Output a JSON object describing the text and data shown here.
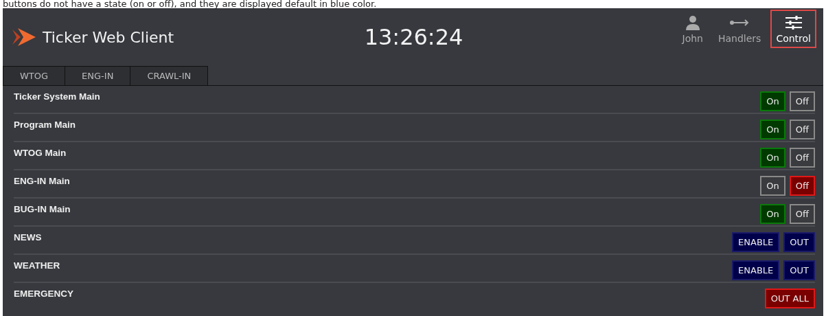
{
  "caption": "buttons do not have a state (on or off), and they are displayed default in blue color.",
  "header": {
    "title": "Ticker Web Client",
    "clock": "13:26:24",
    "nav": [
      {
        "label": "John",
        "kind": "user",
        "selected": false
      },
      {
        "label": "Handlers",
        "kind": "handlers",
        "selected": false
      },
      {
        "label": "Control",
        "kind": "control",
        "selected": true
      }
    ]
  },
  "tabs": [
    {
      "label": "WTOG",
      "selected": false
    },
    {
      "label": "ENG-IN",
      "selected": false
    },
    {
      "label": "CRAWL-IN",
      "selected": false
    }
  ],
  "rows": [
    {
      "name": "Ticker System Main",
      "kind": "toggle",
      "on": true,
      "buttons": [
        "On",
        "Off"
      ]
    },
    {
      "name": "Program Main",
      "kind": "toggle",
      "on": true,
      "buttons": [
        "On",
        "Off"
      ]
    },
    {
      "name": "WTOG Main",
      "kind": "toggle",
      "on": true,
      "buttons": [
        "On",
        "Off"
      ]
    },
    {
      "name": "ENG-IN Main",
      "kind": "toggle",
      "on": false,
      "buttons": [
        "On",
        "Off"
      ]
    },
    {
      "name": "BUG-IN Main",
      "kind": "toggle",
      "on": true,
      "buttons": [
        "On",
        "Off"
      ]
    },
    {
      "name": "NEWS",
      "kind": "action",
      "buttons": [
        "ENABLE",
        "OUT"
      ]
    },
    {
      "name": "WEATHER",
      "kind": "action",
      "buttons": [
        "ENABLE",
        "OUT"
      ]
    },
    {
      "name": "EMERGENCY",
      "kind": "alarm",
      "buttons": [
        "OUT ALL"
      ]
    }
  ]
}
